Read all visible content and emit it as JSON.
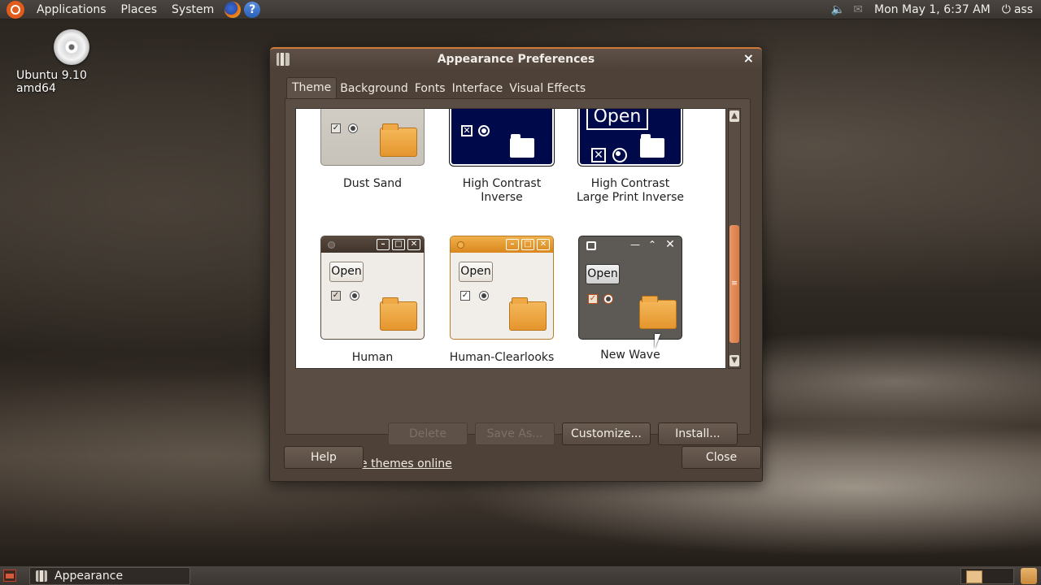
{
  "top_panel": {
    "menu": [
      "Applications",
      "Places",
      "System"
    ],
    "clock": "Mon May  1,  6:37 AM",
    "user": "ass",
    "icons": [
      "ubuntu-logo-icon",
      "firefox-icon",
      "help-icon",
      "volume-icon",
      "mail-icon",
      "power-icon"
    ]
  },
  "desktop": {
    "icon_label": "Ubuntu 9.10 amd64",
    "icon": "cd-icon"
  },
  "window": {
    "title": "Appearance Preferences",
    "close_glyph": "×",
    "tabs": [
      "Theme",
      "Background",
      "Fonts",
      "Interface",
      "Visual Effects"
    ],
    "active_tab": "Theme",
    "themes": [
      {
        "name": "Dust Sand"
      },
      {
        "name": "High Contrast Inverse"
      },
      {
        "name": "High Contrast Large Print Inverse"
      },
      {
        "name": "Human"
      },
      {
        "name": "Human-Clearlooks"
      },
      {
        "name": "New Wave"
      }
    ],
    "preview_open_label": "Open",
    "buttons": {
      "delete": "Delete",
      "save_as": "Save As...",
      "customize": "Customize...",
      "install": "Install..."
    },
    "link": "Get more themes online",
    "help": "Help",
    "close": "Close",
    "accent_color": "#d97a44"
  },
  "taskbar": {
    "task_label": "Appearance Preferences"
  }
}
